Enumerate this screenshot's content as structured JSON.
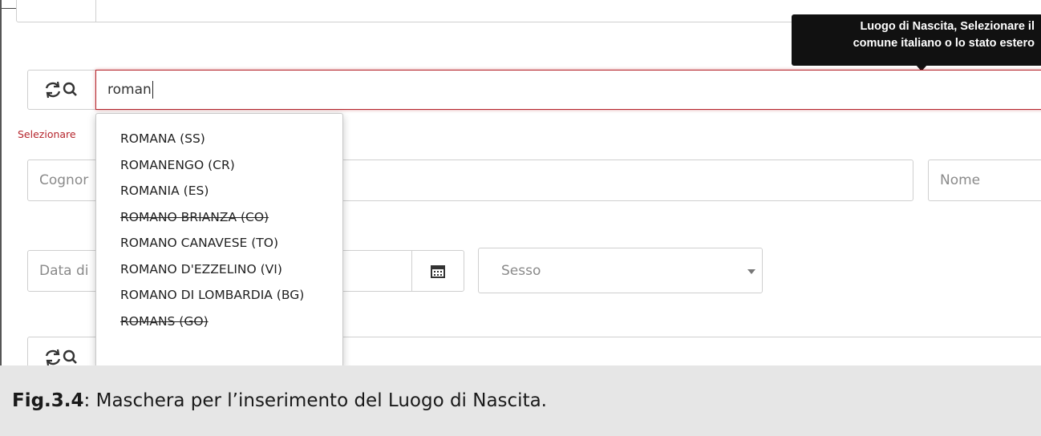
{
  "tooltip": {
    "line1": "Luogo di Nascita, Selezionare il",
    "line2": "comune italiano o lo stato estero"
  },
  "birthplace": {
    "value": "roman",
    "error": "Selezionare"
  },
  "dropdown": {
    "items": [
      {
        "label": "ROMANA (SS)",
        "disabled": false
      },
      {
        "label": "ROMANENGO (CR)",
        "disabled": false
      },
      {
        "label": "ROMANIA (ES)",
        "disabled": false
      },
      {
        "label": "ROMANO BRIANZA (CO)",
        "disabled": true
      },
      {
        "label": "ROMANO CANAVESE (TO)",
        "disabled": false
      },
      {
        "label": "ROMANO D'EZZELINO (VI)",
        "disabled": false
      },
      {
        "label": "ROMANO DI LOMBARDIA (BG)",
        "disabled": false
      },
      {
        "label": "ROMANS (GO)",
        "disabled": true
      }
    ]
  },
  "fields": {
    "cognome_placeholder": "Cognor",
    "nome_placeholder": "Nome",
    "data_placeholder": "Data di",
    "sesso_placeholder": "Sesso"
  },
  "icons": {
    "refresh_search": "refresh-search-icon",
    "calendar": "calendar-icon",
    "select_caret": "caret-down-icon"
  },
  "colors": {
    "error": "#b5242b",
    "tooltip_bg": "#111111"
  },
  "caption": {
    "label": "Fig.3.4",
    "text": ": Maschera per l’inserimento del Luogo di Nascita."
  }
}
